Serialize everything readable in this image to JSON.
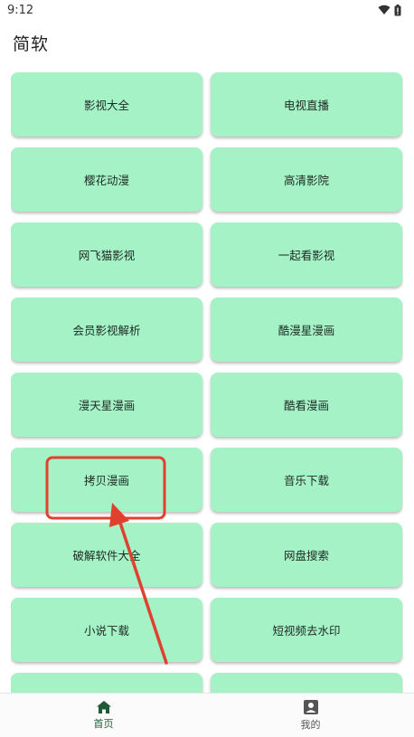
{
  "status_bar": {
    "time": "9:12",
    "wifi_icon": "wifi-icon",
    "battery_icon": "battery-icon"
  },
  "app_title": "简软",
  "tiles": [
    "影视大全",
    "电视直播",
    "樱花动漫",
    "高清影院",
    "网飞猫影视",
    "一起看影视",
    "会员影视解析",
    "酷漫星漫画",
    "漫天星漫画",
    "酷看漫画",
    "拷贝漫画",
    "音乐下载",
    "破解软件大全",
    "网盘搜索",
    "小说下载",
    "短视频去水印",
    "",
    ""
  ],
  "bottom_nav": {
    "home": {
      "label": "首页",
      "icon": "home-icon"
    },
    "mine": {
      "label": "我的",
      "icon": "account-box-icon"
    }
  },
  "colors": {
    "tile_bg": "#a4f2c6",
    "nav_active": "#1f5a36",
    "annotation": "#e0412e"
  }
}
